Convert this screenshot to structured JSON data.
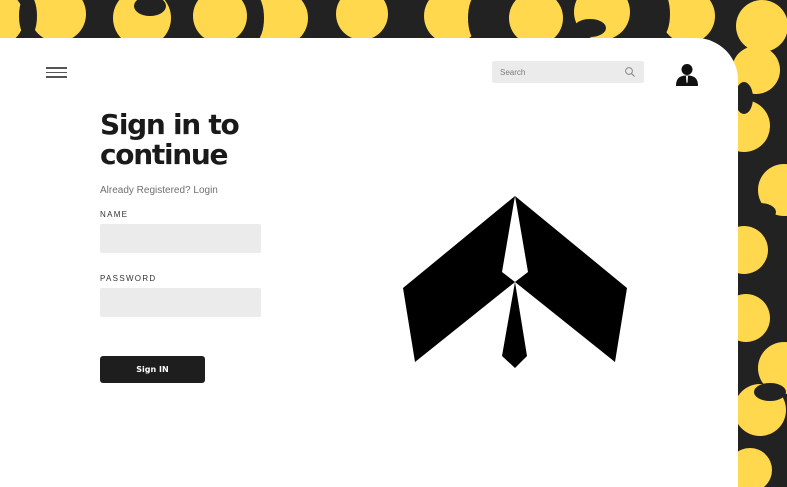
{
  "colors": {
    "accent": "#ffd84d",
    "dark": "#222222",
    "card": "#ffffff",
    "input": "#ebebeb",
    "button": "#1e1e1e"
  },
  "header": {
    "menu_icon": "hamburger-menu-icon",
    "search": {
      "placeholder": "Search",
      "icon": "search-icon"
    },
    "profile_icon": "user-avatar-icon"
  },
  "form": {
    "title": "Sign in to continue",
    "subtitle": "Already Registered? Login",
    "name_label": "NAME",
    "password_label": "PASSWORD",
    "submit_label": "Sign IN"
  },
  "illustration": {
    "icon": "arrow-logo-icon"
  }
}
